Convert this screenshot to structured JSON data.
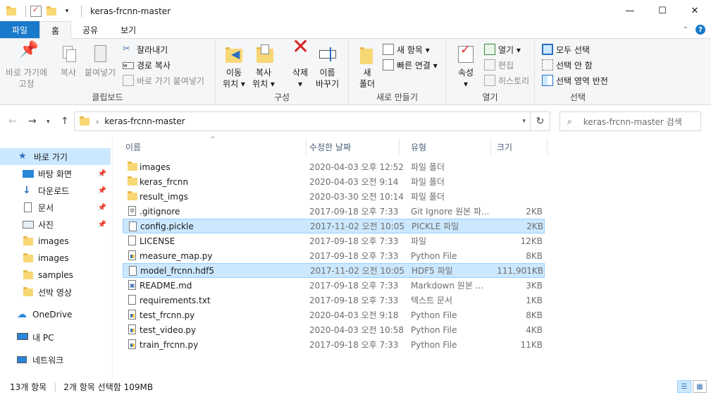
{
  "window": {
    "title": "keras-frcnn-master",
    "controls": [
      "—",
      "☐",
      "✕"
    ]
  },
  "ribbon_tabs": [
    "파일",
    "홈",
    "공유",
    "보기"
  ],
  "ribbon": {
    "clipboard": {
      "label": "클립보드",
      "pin_quick": [
        "바로 가기에",
        "고정"
      ],
      "copy": "복사",
      "paste": "붙여넣기",
      "cut": "잘라내기",
      "copy_path": "경로 복사",
      "paste_shortcut": "바로 가기 붙여넣기"
    },
    "organize": {
      "label": "구성",
      "move_to": [
        "이동",
        "위치 ▾"
      ],
      "copy_to": [
        "복사",
        "위치 ▾"
      ],
      "delete": [
        "삭제",
        "▾"
      ],
      "rename": [
        "이름",
        "바꾸기"
      ]
    },
    "new": {
      "label": "새로 만들기",
      "new_folder": [
        "새",
        "폴더"
      ],
      "new_item": "새 항목 ▾",
      "easy_access": "빠른 연결 ▾"
    },
    "open": {
      "label": "열기",
      "properties": [
        "속성",
        "▾"
      ],
      "open": "열기 ▾",
      "edit": "편집",
      "history": "히스토리"
    },
    "select": {
      "label": "선택",
      "select_all": "모두 선택",
      "select_none": "선택 안 함",
      "invert": "선택 영역 반전"
    }
  },
  "address": {
    "path": "keras-frcnn-master",
    "search_placeholder": "keras-frcnn-master 검색"
  },
  "nav_pane": [
    {
      "label": "바로 가기",
      "icon": "star-icon",
      "pinned": false
    },
    {
      "label": "바탕 화면",
      "icon": "desktop-icon",
      "pinned": true
    },
    {
      "label": "다운로드",
      "icon": "download-icon",
      "pinned": true
    },
    {
      "label": "문서",
      "icon": "document-icon",
      "pinned": true
    },
    {
      "label": "사진",
      "icon": "pictures-icon",
      "pinned": true
    },
    {
      "label": "images",
      "icon": "folder-icon",
      "pinned": false
    },
    {
      "label": "images",
      "icon": "folder-icon",
      "pinned": false
    },
    {
      "label": "samples",
      "icon": "folder-icon",
      "pinned": false
    },
    {
      "label": "선박 영상",
      "icon": "folder-icon",
      "pinned": false
    },
    {
      "label": "OneDrive",
      "icon": "cloud-icon",
      "pinned": false
    },
    {
      "label": "내 PC",
      "icon": "pc-icon",
      "pinned": false
    },
    {
      "label": "네트워크",
      "icon": "network-icon",
      "pinned": false
    }
  ],
  "columns": [
    "이름",
    "수정한 날짜",
    "유형",
    "크기"
  ],
  "files": [
    {
      "name": "images",
      "date": "2020-04-03 오후 12:52",
      "type": "파일 폴더",
      "size": "",
      "icon": "folder",
      "selected": false
    },
    {
      "name": "keras_frcnn",
      "date": "2020-04-03 오전 9:14",
      "type": "파일 폴더",
      "size": "",
      "icon": "folder",
      "selected": false
    },
    {
      "name": "result_imgs",
      "date": "2020-03-30 오전 10:14",
      "type": "파일 폴더",
      "size": "",
      "icon": "folder",
      "selected": false
    },
    {
      "name": ".gitignore",
      "date": "2017-09-18 오후 7:33",
      "type": "Git Ignore 원본 파...",
      "size": "2KB",
      "icon": "gear",
      "selected": false
    },
    {
      "name": "config.pickle",
      "date": "2017-11-02 오전 10:05",
      "type": "PICKLE 파일",
      "size": "2KB",
      "icon": "doc",
      "selected": true
    },
    {
      "name": "LICENSE",
      "date": "2017-09-18 오후 7:33",
      "type": "파일",
      "size": "12KB",
      "icon": "doc",
      "selected": false
    },
    {
      "name": "measure_map.py",
      "date": "2017-09-18 오후 7:33",
      "type": "Python File",
      "size": "8KB",
      "icon": "py",
      "selected": false
    },
    {
      "name": "model_frcnn.hdf5",
      "date": "2017-11-02 오전 10:05",
      "type": "HDF5 파일",
      "size": "111,901KB",
      "icon": "doc",
      "selected": true
    },
    {
      "name": "README.md",
      "date": "2017-09-18 오후 7:33",
      "type": "Markdown 원본 ...",
      "size": "3KB",
      "icon": "md",
      "selected": false
    },
    {
      "name": "requirements.txt",
      "date": "2017-09-18 오후 7:33",
      "type": "텍스트 문서",
      "size": "1KB",
      "icon": "doc",
      "selected": false
    },
    {
      "name": "test_frcnn.py",
      "date": "2020-04-03 오전 9:18",
      "type": "Python File",
      "size": "8KB",
      "icon": "py",
      "selected": false
    },
    {
      "name": "test_video.py",
      "date": "2020-04-03 오전 10:58",
      "type": "Python File",
      "size": "4KB",
      "icon": "py",
      "selected": false
    },
    {
      "name": "train_frcnn.py",
      "date": "2017-09-18 오후 7:33",
      "type": "Python File",
      "size": "11KB",
      "icon": "py",
      "selected": false
    }
  ],
  "status": {
    "count": "13개 항목",
    "selection": "2개 항목 선택함 109MB"
  },
  "colors": {
    "accent": "#1979ca",
    "selection": "#cce8ff",
    "folder": "#f8d775"
  }
}
